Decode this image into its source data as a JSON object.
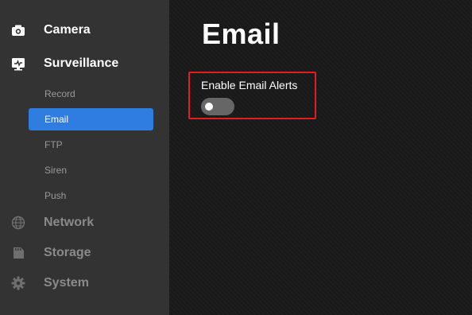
{
  "sidebar": {
    "sections": [
      {
        "label": "Camera",
        "icon": "camera-icon"
      },
      {
        "label": "Surveillance",
        "icon": "monitor-icon"
      },
      {
        "label": "Network",
        "icon": "globe-icon"
      },
      {
        "label": "Storage",
        "icon": "storage-icon"
      },
      {
        "label": "System",
        "icon": "gear-icon"
      }
    ],
    "surveillance_items": [
      {
        "label": "Record"
      },
      {
        "label": "Email",
        "active": true
      },
      {
        "label": "FTP"
      },
      {
        "label": "Siren"
      },
      {
        "label": "Push"
      }
    ]
  },
  "main": {
    "title": "Email",
    "setting": {
      "label": "Enable Email Alerts",
      "enabled": false
    }
  },
  "colors": {
    "accent": "#2f7de1",
    "highlight_border": "#e02020",
    "sidebar_bg": "#333333",
    "main_bg": "#1b1b1b",
    "toggle_off": "#666666"
  }
}
